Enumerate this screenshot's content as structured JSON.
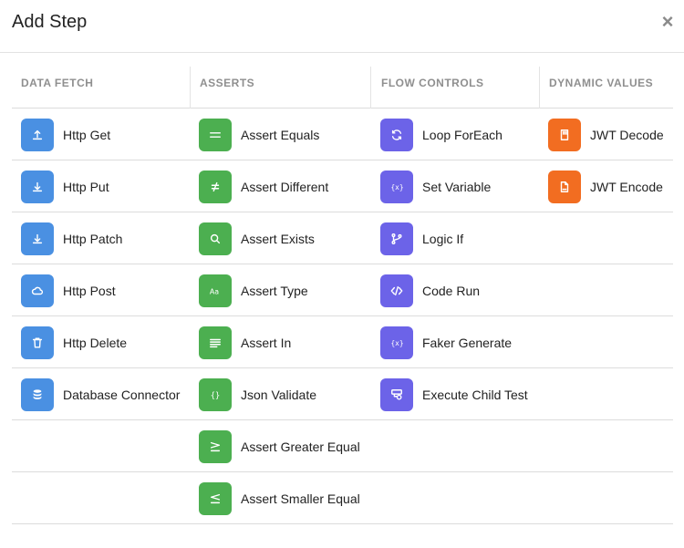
{
  "dialog": {
    "title": "Add Step",
    "close_glyph": "×"
  },
  "colors": {
    "blue": "#4a90e2",
    "green": "#4caf50",
    "purple": "#6c63e8",
    "orange": "#f26d21"
  },
  "columns": [
    {
      "header": "DATA FETCH",
      "color": "#4a90e2",
      "items": [
        {
          "label": "Http Get",
          "icon": "upload-icon"
        },
        {
          "label": "Http Put",
          "icon": "download-icon"
        },
        {
          "label": "Http Patch",
          "icon": "download-icon"
        },
        {
          "label": "Http Post",
          "icon": "cloud-icon"
        },
        {
          "label": "Http Delete",
          "icon": "trash-icon"
        },
        {
          "label": "Database Connector",
          "icon": "database-icon"
        }
      ]
    },
    {
      "header": "ASSERTS",
      "color": "#4caf50",
      "items": [
        {
          "label": "Assert Equals",
          "icon": "equals-icon"
        },
        {
          "label": "Assert Different",
          "icon": "not-equal-icon"
        },
        {
          "label": "Assert Exists",
          "icon": "search-icon"
        },
        {
          "label": "Assert Type",
          "icon": "text-type-icon"
        },
        {
          "label": "Assert In",
          "icon": "align-left-icon"
        },
        {
          "label": "Json Validate",
          "icon": "braces-icon"
        },
        {
          "label": "Assert Greater Equal",
          "icon": "greater-equal-icon"
        },
        {
          "label": "Assert Smaller Equal",
          "icon": "less-equal-icon"
        }
      ]
    },
    {
      "header": "FLOW CONTROLS",
      "color": "#6c63e8",
      "items": [
        {
          "label": "Loop ForEach",
          "icon": "refresh-icon"
        },
        {
          "label": "Set Variable",
          "icon": "variable-icon"
        },
        {
          "label": "Logic If",
          "icon": "git-branch-icon"
        },
        {
          "label": "Code Run",
          "icon": "code-icon"
        },
        {
          "label": "Faker Generate",
          "icon": "variable-icon"
        },
        {
          "label": "Execute Child Test",
          "icon": "child-test-icon"
        }
      ]
    },
    {
      "header": "DYNAMIC VALUES",
      "color": "#f26d21",
      "items": [
        {
          "label": "JWT Decode",
          "icon": "jwt-decode-icon"
        },
        {
          "label": "JWT Encode",
          "icon": "jwt-encode-icon"
        }
      ]
    }
  ]
}
